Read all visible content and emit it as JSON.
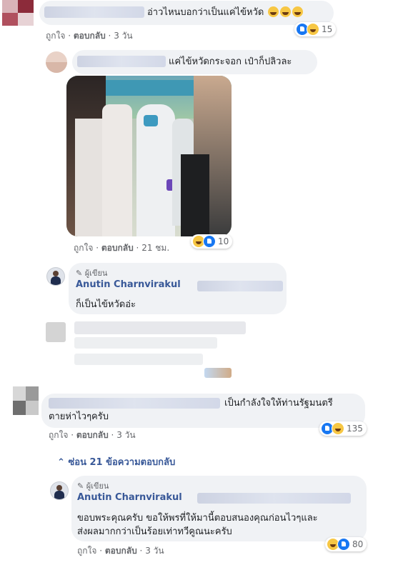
{
  "comments": [
    {
      "text": "อ่าวไหนบอกว่าเป็นแค่ไข้หวัด",
      "actions": {
        "like": "ถูกใจ",
        "reply": "ตอบกลับ",
        "time": "3 วัน"
      },
      "reaction_count": "15"
    }
  ],
  "reply1": {
    "text": "แค่ไข้หวัดกระจอก เป๋าก็ปลิวละ",
    "actions": {
      "like": "ถูกใจ",
      "reply": "ตอบกลับ",
      "time": "21 ชม."
    },
    "reaction_count": "10"
  },
  "author_reply1": {
    "badge": "ผู้เขียน",
    "name": "Anutin Charnvirakul",
    "text": "ก็เป็นไข้หวัดอ่ะ"
  },
  "comment2": {
    "text_line1": "เป็นกำลังใจให้ท่านรัฐมนตรี",
    "text_line2": "ตายห่าไวๆครับ",
    "actions": {
      "like": "ถูกใจ",
      "reply": "ตอบกลับ",
      "time": "3 วัน"
    },
    "reaction_count": "135"
  },
  "hidden_replies": {
    "label": "ซ่อน 21 ข้อความตอบกลับ"
  },
  "author_reply2": {
    "badge": "ผู้เขียน",
    "name": "Anutin Charnvirakul",
    "text_line1": "ขอบพระคุณครับ ขอให้พรที่ให้มานี้ตอบสนองคุณก่อนไวๆและ",
    "text_line2": "ส่งผลมากกว่าเป็นร้อยเท่าทวีคูณนะครับ",
    "actions": {
      "like": "ถูกใจ",
      "reply": "ตอบกลับ",
      "time": "3 วัน"
    },
    "reaction_count": "80"
  },
  "colors": {
    "link": "#385898",
    "meta": "#65676b",
    "bubble": "#f0f2f5",
    "like": "#1877f2"
  }
}
